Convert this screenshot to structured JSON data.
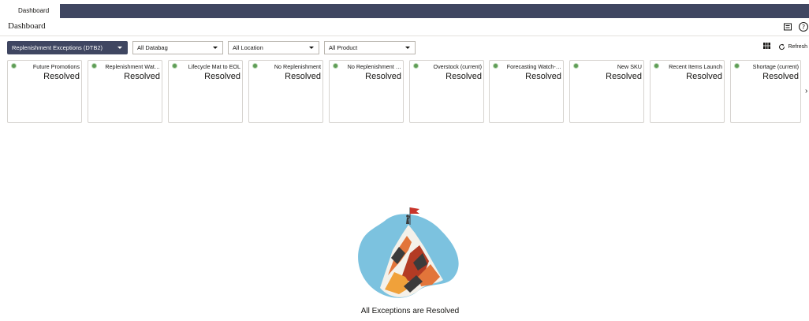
{
  "tab": {
    "label": "Dashboard"
  },
  "header": {
    "title": "Dashboard"
  },
  "filters": {
    "dashboard": "Replenishment Exceptions (DTB2)",
    "databag": "All Databag",
    "location": "All Location",
    "product": "All Product"
  },
  "toolbar": {
    "refresh_label": "Refresh"
  },
  "cards": [
    {
      "name": "Future Promotions",
      "status": "Resolved"
    },
    {
      "name": "Replenishment Wat…",
      "status": "Resolved"
    },
    {
      "name": "Lifecycle Mat to EOL",
      "status": "Resolved"
    },
    {
      "name": "No Replenishment",
      "status": "Resolved"
    },
    {
      "name": "No Replenishment …",
      "status": "Resolved"
    },
    {
      "name": "Overstock (current)",
      "status": "Resolved"
    },
    {
      "name": "Forecasting Watch-…",
      "status": "Resolved"
    },
    {
      "name": "New SKU",
      "status": "Resolved"
    },
    {
      "name": "Recent Items Launch",
      "status": "Resolved"
    },
    {
      "name": "Shortage (current)",
      "status": "Resolved"
    }
  ],
  "empty_state": {
    "message": "All Exceptions are Resolved"
  },
  "colors": {
    "accent": "#3f4661",
    "status_dot": "#5f9d57"
  }
}
